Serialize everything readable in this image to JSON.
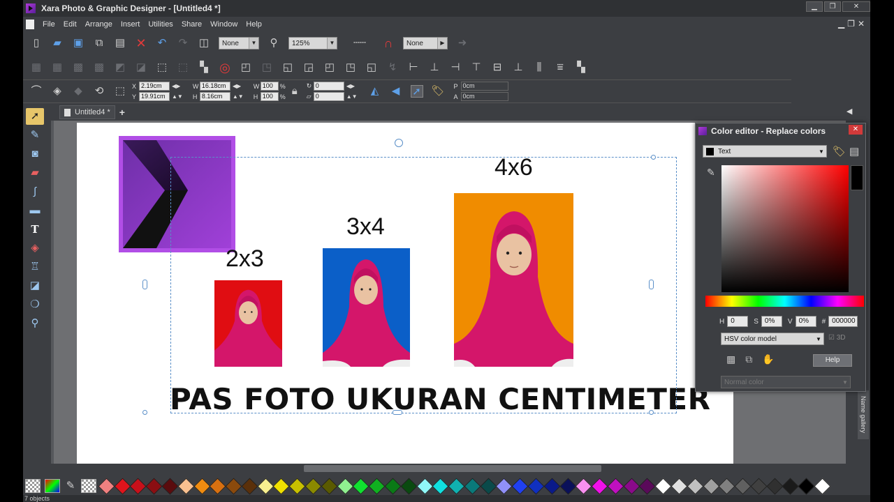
{
  "window": {
    "title": "Xara Photo & Graphic Designer - [Untitled4 *]",
    "controls": {
      "minimize": "▁",
      "restore": "❐",
      "close": "✕"
    }
  },
  "menu": [
    "File",
    "Edit",
    "Arrange",
    "Insert",
    "Utilities",
    "Share",
    "Window",
    "Help"
  ],
  "toolbar": {
    "blend_mode": "None",
    "zoom": "125%",
    "feather": "None"
  },
  "infobar": {
    "x": "2.19cm",
    "y": "19.91cm",
    "w": "16.18cm",
    "h": "8.16cm",
    "w_pct": "100",
    "h_pct": "100",
    "rotate": "0",
    "skew": "0",
    "p": "0cm",
    "a": "0cm",
    "labels": {
      "x": "X",
      "y": "Y",
      "w": "W",
      "h": "H",
      "pct": "%",
      "p": "P",
      "a": "A"
    }
  },
  "tabs": [
    {
      "label": "Untitled4 *"
    }
  ],
  "document": {
    "labels": {
      "small": "2x3",
      "medium": "3x4",
      "large": "4x6"
    },
    "headline": "PAS FOTO UKURAN CENTIMETER",
    "photo_backgrounds": {
      "small": "#e00d12",
      "medium": "#0b5fc8",
      "large": "#f08c00"
    }
  },
  "color_editor": {
    "title": "Color editor - Replace colors",
    "target": "Text",
    "h": "0",
    "s": "0%",
    "v": "0%",
    "hex": "000000",
    "labels": {
      "h": "H",
      "s": "S",
      "v": "V",
      "hash": "#"
    },
    "model": "HSV color model",
    "three_d": "3D",
    "help": "Help",
    "named_color": "Normal color"
  },
  "gallery_tab": "Name gallery",
  "status": "7 objects",
  "palette": [
    "#f08080",
    "#e0141c",
    "#c8101a",
    "#8b0e12",
    "#5a0c0e",
    "#f8c090",
    "#f08c10",
    "#d87010",
    "#8b4a0c",
    "#5a300a",
    "#f8f090",
    "#f0e000",
    "#c8c000",
    "#8b8a00",
    "#5a5a00",
    "#90f090",
    "#10e030",
    "#10b020",
    "#0a7a16",
    "#0a4a10",
    "#90f8f8",
    "#10e0e0",
    "#10b0b0",
    "#0a7a7a",
    "#0a4a4a",
    "#9090f8",
    "#2040f0",
    "#1030c0",
    "#0a1a8a",
    "#0a105a",
    "#f890f0",
    "#f010e8",
    "#c010c0",
    "#8a0a8a",
    "#5a0a5a",
    "#ffffff",
    "#e0e0e0",
    "#c0c0c0",
    "#a0a0a0",
    "#808080",
    "#606060",
    "#404040",
    "#303030",
    "#1a1a1a",
    "#000000",
    "#ffffff"
  ]
}
